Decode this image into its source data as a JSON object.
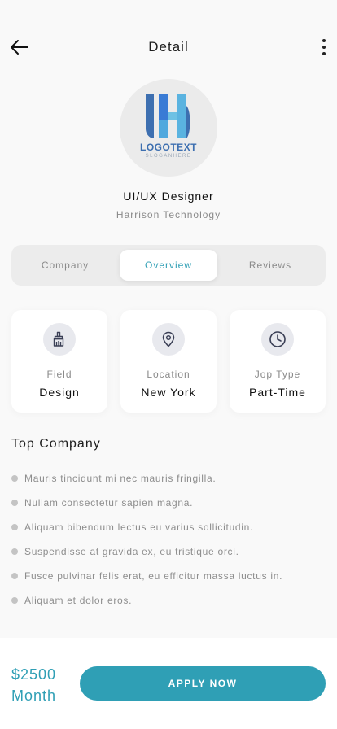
{
  "header": {
    "title": "Detail",
    "back_icon": "arrow-left-icon",
    "more_icon": "more-vertical-icon"
  },
  "logo": {
    "text": "LOGOTEXT",
    "slogan": "SLOGANHERE"
  },
  "job": {
    "title": "UI/UX Designer",
    "company": "Harrison Technology"
  },
  "tabs": [
    {
      "label": "Company",
      "active": false
    },
    {
      "label": "Overview",
      "active": true
    },
    {
      "label": "Reviews",
      "active": false
    }
  ],
  "cards": [
    {
      "icon": "paint-brush-icon",
      "label": "Field",
      "value": "Design"
    },
    {
      "icon": "location-pin-icon",
      "label": "Location",
      "value": "New York"
    },
    {
      "icon": "clock-icon",
      "label": "Jop Type",
      "value": "Part-Time"
    }
  ],
  "section": {
    "title": "Top Company",
    "items": [
      "Mauris tincidunt mi nec mauris fringilla.",
      "Nullam consectetur sapien magna.",
      "Aliquam bibendum lectus eu varius sollicitudin.",
      "Suspendisse at gravida ex, eu tristique orci.",
      "Fusce pulvinar felis erat, eu efficitur massa luctus in.",
      "Aliquam et dolor eros."
    ]
  },
  "footer": {
    "price": "$2500",
    "period": "Month",
    "apply_label": "APPLY NOW"
  },
  "colors": {
    "accent": "#2f9fb5",
    "background": "#f9f9f9"
  }
}
